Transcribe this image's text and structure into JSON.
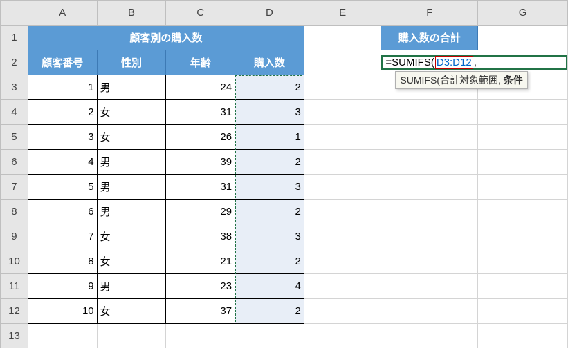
{
  "columns": [
    "A",
    "B",
    "C",
    "D",
    "E",
    "F",
    "G"
  ],
  "rows": [
    "1",
    "2",
    "3",
    "4",
    "5",
    "6",
    "7",
    "8",
    "9",
    "10",
    "11",
    "12",
    "13"
  ],
  "table": {
    "title": "顧客別の購入数",
    "headers": {
      "id": "顧客番号",
      "gender": "性別",
      "age": "年齢",
      "qty": "購入数"
    },
    "data": [
      {
        "id": "1",
        "gender": "男",
        "age": "24",
        "qty": "2"
      },
      {
        "id": "2",
        "gender": "女",
        "age": "31",
        "qty": "3"
      },
      {
        "id": "3",
        "gender": "女",
        "age": "26",
        "qty": "1"
      },
      {
        "id": "4",
        "gender": "男",
        "age": "39",
        "qty": "2"
      },
      {
        "id": "5",
        "gender": "男",
        "age": "31",
        "qty": "3"
      },
      {
        "id": "6",
        "gender": "男",
        "age": "29",
        "qty": "2"
      },
      {
        "id": "7",
        "gender": "女",
        "age": "38",
        "qty": "3"
      },
      {
        "id": "8",
        "gender": "女",
        "age": "21",
        "qty": "2"
      },
      {
        "id": "9",
        "gender": "男",
        "age": "23",
        "qty": "4"
      },
      {
        "id": "10",
        "gender": "女",
        "age": "37",
        "qty": "2"
      }
    ]
  },
  "summary": {
    "title": "購入数の合計",
    "formula_prefix": "=SUMIFS(",
    "formula_ref": "D3:D12",
    "formula_suffix": ","
  },
  "tooltip": {
    "fn": "SUMIFS",
    "arg1": "合計対象範囲",
    "arg2": "条件"
  }
}
